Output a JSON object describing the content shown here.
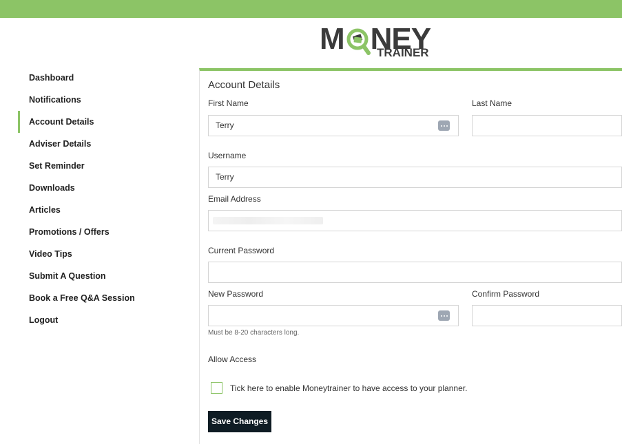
{
  "brand": {
    "logo_part1": "M",
    "logo_part2": "NEY",
    "logo_sub": "TRAINER",
    "accent_color": "#8cc466",
    "dark_color": "#3b3b3b"
  },
  "sidebar": {
    "items": [
      {
        "label": "Dashboard",
        "active": false
      },
      {
        "label": "Notifications",
        "active": false
      },
      {
        "label": "Account Details",
        "active": true
      },
      {
        "label": "Adviser Details",
        "active": false
      },
      {
        "label": "Set Reminder",
        "active": false
      },
      {
        "label": "Downloads",
        "active": false
      },
      {
        "label": "Articles",
        "active": false
      },
      {
        "label": "Promotions / Offers",
        "active": false
      },
      {
        "label": "Video Tips",
        "active": false
      },
      {
        "label": "Submit A Question",
        "active": false
      },
      {
        "label": "Book a Free Q&A Session",
        "active": false
      },
      {
        "label": "Logout",
        "active": false
      }
    ]
  },
  "form": {
    "title": "Account Details",
    "first_name": {
      "label": "First Name",
      "value": "Terry"
    },
    "last_name": {
      "label": "Last Name",
      "value": ""
    },
    "username": {
      "label": "Username",
      "value": "Terry"
    },
    "email": {
      "label": "Email Address",
      "value": ""
    },
    "current_password": {
      "label": "Current Password",
      "value": ""
    },
    "new_password": {
      "label": "New Password",
      "value": "",
      "hint": "Must be 8-20 characters long."
    },
    "confirm_password": {
      "label": "Confirm Password",
      "value": ""
    },
    "allow_access": {
      "label": "Allow Access",
      "checkbox_label": "Tick here to enable Moneytrainer to have access to your planner.",
      "checked": false
    },
    "save_label": "Save Changes"
  }
}
